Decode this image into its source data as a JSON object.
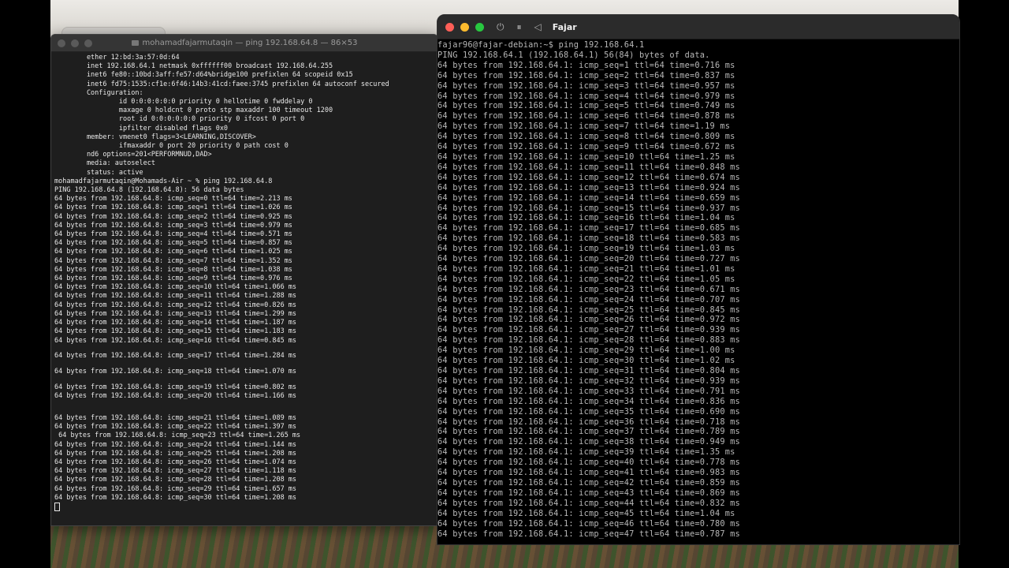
{
  "left_terminal": {
    "title": "mohamadfajarmutaqin — ping 192.168.64.8 — 86×53",
    "lines": [
      "        ether 12:bd:3a:57:0d:64",
      "        inet 192.168.64.1 netmask 0xffffff00 broadcast 192.168.64.255",
      "        inet6 fe80::10bd:3aff:fe57:d64%bridge100 prefixlen 64 scopeid 0x15",
      "        inet6 fd75:1535:cf1e:6f46:14b3:41cd:faee:3745 prefixlen 64 autoconf secured",
      "        Configuration:",
      "                id 0:0:0:0:0:0 priority 0 hellotime 0 fwddelay 0",
      "                maxage 0 holdcnt 0 proto stp maxaddr 100 timeout 1200",
      "                root id 0:0:0:0:0:0 priority 0 ifcost 0 port 0",
      "                ipfilter disabled flags 0x0",
      "        member: vmenet0 flags=3<LEARNING,DISCOVER>",
      "                ifmaxaddr 0 port 20 priority 0 path cost 0",
      "        nd6 options=201<PERFORMNUD,DAD>",
      "        media: autoselect",
      "        status: active",
      "mohamadfajarmutaqin@Mohamads-Air ~ % ping 192.168.64.8",
      "PING 192.168.64.8 (192.168.64.8): 56 data bytes",
      "64 bytes from 192.168.64.8: icmp_seq=0 ttl=64 time=2.213 ms",
      "64 bytes from 192.168.64.8: icmp_seq=1 ttl=64 time=1.026 ms",
      "64 bytes from 192.168.64.8: icmp_seq=2 ttl=64 time=0.925 ms",
      "64 bytes from 192.168.64.8: icmp_seq=3 ttl=64 time=0.979 ms",
      "64 bytes from 192.168.64.8: icmp_seq=4 ttl=64 time=0.571 ms",
      "64 bytes from 192.168.64.8: icmp_seq=5 ttl=64 time=0.857 ms",
      "64 bytes from 192.168.64.8: icmp_seq=6 ttl=64 time=1.025 ms",
      "64 bytes from 192.168.64.8: icmp_seq=7 ttl=64 time=1.352 ms",
      "64 bytes from 192.168.64.8: icmp_seq=8 ttl=64 time=1.038 ms",
      "64 bytes from 192.168.64.8: icmp_seq=9 ttl=64 time=0.976 ms",
      "64 bytes from 192.168.64.8: icmp_seq=10 ttl=64 time=1.066 ms",
      "64 bytes from 192.168.64.8: icmp_seq=11 ttl=64 time=1.288 ms",
      "64 bytes from 192.168.64.8: icmp_seq=12 ttl=64 time=0.826 ms",
      "64 bytes from 192.168.64.8: icmp_seq=13 ttl=64 time=1.299 ms",
      "64 bytes from 192.168.64.8: icmp_seq=14 ttl=64 time=1.187 ms",
      "64 bytes from 192.168.64.8: icmp_seq=15 ttl=64 time=1.183 ms",
      "64 bytes from 192.168.64.8: icmp_seq=16 ttl=64 time=0.845 ms",
      "",
      "64 bytes from 192.168.64.8: icmp_seq=17 ttl=64 time=1.284 ms",
      "",
      "64 bytes from 192.168.64.8: icmp_seq=18 ttl=64 time=1.070 ms",
      "",
      "64 bytes from 192.168.64.8: icmp_seq=19 ttl=64 time=0.802 ms",
      "64 bytes from 192.168.64.8: icmp_seq=20 ttl=64 time=1.166 ms",
      "",
      "",
      "64 bytes from 192.168.64.8: icmp_seq=21 ttl=64 time=1.089 ms",
      "64 bytes from 192.168.64.8: icmp_seq=22 ttl=64 time=1.397 ms",
      " 64 bytes from 192.168.64.8: icmp_seq=23 ttl=64 time=1.265 ms",
      "64 bytes from 192.168.64.8: icmp_seq=24 ttl=64 time=1.144 ms",
      "64 bytes from 192.168.64.8: icmp_seq=25 ttl=64 time=1.208 ms",
      "64 bytes from 192.168.64.8: icmp_seq=26 ttl=64 time=1.074 ms",
      "64 bytes from 192.168.64.8: icmp_seq=27 ttl=64 time=1.118 ms",
      "64 bytes from 192.168.64.8: icmp_seq=28 ttl=64 time=1.208 ms",
      "64 bytes from 192.168.64.8: icmp_seq=29 ttl=64 time=1.657 ms",
      "64 bytes from 192.168.64.8: icmp_seq=30 ttl=64 time=1.208 ms"
    ]
  },
  "right_terminal": {
    "title": "Fajar",
    "toolbar_icons": [
      "power-icon",
      "pause-icon",
      "back-icon"
    ],
    "lines": [
      "fajar96@fajar-debian:~$ ping 192.168.64.1",
      "PING 192.168.64.1 (192.168.64.1) 56(84) bytes of data.",
      "64 bytes from 192.168.64.1: icmp_seq=1 ttl=64 time=0.716 ms",
      "64 bytes from 192.168.64.1: icmp_seq=2 ttl=64 time=0.837 ms",
      "64 bytes from 192.168.64.1: icmp_seq=3 ttl=64 time=0.957 ms",
      "64 bytes from 192.168.64.1: icmp_seq=4 ttl=64 time=0.979 ms",
      "64 bytes from 192.168.64.1: icmp_seq=5 ttl=64 time=0.749 ms",
      "64 bytes from 192.168.64.1: icmp_seq=6 ttl=64 time=0.878 ms",
      "64 bytes from 192.168.64.1: icmp_seq=7 ttl=64 time=1.19 ms",
      "64 bytes from 192.168.64.1: icmp_seq=8 ttl=64 time=0.809 ms",
      "64 bytes from 192.168.64.1: icmp_seq=9 ttl=64 time=0.672 ms",
      "64 bytes from 192.168.64.1: icmp_seq=10 ttl=64 time=1.25 ms",
      "64 bytes from 192.168.64.1: icmp_seq=11 ttl=64 time=0.848 ms",
      "64 bytes from 192.168.64.1: icmp_seq=12 ttl=64 time=0.674 ms",
      "64 bytes from 192.168.64.1: icmp_seq=13 ttl=64 time=0.924 ms",
      "64 bytes from 192.168.64.1: icmp_seq=14 ttl=64 time=0.659 ms",
      "64 bytes from 192.168.64.1: icmp_seq=15 ttl=64 time=0.937 ms",
      "64 bytes from 192.168.64.1: icmp_seq=16 ttl=64 time=1.04 ms",
      "64 bytes from 192.168.64.1: icmp_seq=17 ttl=64 time=0.685 ms",
      "64 bytes from 192.168.64.1: icmp_seq=18 ttl=64 time=0.583 ms",
      "64 bytes from 192.168.64.1: icmp_seq=19 ttl=64 time=1.03 ms",
      "64 bytes from 192.168.64.1: icmp_seq=20 ttl=64 time=0.727 ms",
      "64 bytes from 192.168.64.1: icmp_seq=21 ttl=64 time=1.01 ms",
      "64 bytes from 192.168.64.1: icmp_seq=22 ttl=64 time=1.05 ms",
      "64 bytes from 192.168.64.1: icmp_seq=23 ttl=64 time=0.671 ms",
      "64 bytes from 192.168.64.1: icmp_seq=24 ttl=64 time=0.707 ms",
      "64 bytes from 192.168.64.1: icmp_seq=25 ttl=64 time=0.845 ms",
      "64 bytes from 192.168.64.1: icmp_seq=26 ttl=64 time=0.972 ms",
      "64 bytes from 192.168.64.1: icmp_seq=27 ttl=64 time=0.939 ms",
      "64 bytes from 192.168.64.1: icmp_seq=28 ttl=64 time=0.883 ms",
      "64 bytes from 192.168.64.1: icmp_seq=29 ttl=64 time=1.00 ms",
      "64 bytes from 192.168.64.1: icmp_seq=30 ttl=64 time=1.02 ms",
      "64 bytes from 192.168.64.1: icmp_seq=31 ttl=64 time=0.804 ms",
      "64 bytes from 192.168.64.1: icmp_seq=32 ttl=64 time=0.939 ms",
      "64 bytes from 192.168.64.1: icmp_seq=33 ttl=64 time=0.791 ms",
      "64 bytes from 192.168.64.1: icmp_seq=34 ttl=64 time=0.836 ms",
      "64 bytes from 192.168.64.1: icmp_seq=35 ttl=64 time=0.690 ms",
      "64 bytes from 192.168.64.1: icmp_seq=36 ttl=64 time=0.718 ms",
      "64 bytes from 192.168.64.1: icmp_seq=37 ttl=64 time=0.789 ms",
      "64 bytes from 192.168.64.1: icmp_seq=38 ttl=64 time=0.949 ms",
      "64 bytes from 192.168.64.1: icmp_seq=39 ttl=64 time=1.35 ms",
      "64 bytes from 192.168.64.1: icmp_seq=40 ttl=64 time=0.778 ms",
      "64 bytes from 192.168.64.1: icmp_seq=41 ttl=64 time=0.983 ms",
      "64 bytes from 192.168.64.1: icmp_seq=42 ttl=64 time=0.859 ms",
      "64 bytes from 192.168.64.1: icmp_seq=43 ttl=64 time=0.869 ms",
      "64 bytes from 192.168.64.1: icmp_seq=44 ttl=64 time=0.832 ms",
      "64 bytes from 192.168.64.1: icmp_seq=45 ttl=64 time=1.04 ms",
      "64 bytes from 192.168.64.1: icmp_seq=46 ttl=64 time=0.780 ms",
      "64 bytes from 192.168.64.1: icmp_seq=47 ttl=64 time=0.787 ms"
    ]
  },
  "colors": {
    "close": "#ff5f57",
    "minimize": "#febc2e",
    "zoom": "#28c840",
    "left_terminal_bg": "#1e1e1e",
    "right_terminal_bg": "#000000"
  }
}
